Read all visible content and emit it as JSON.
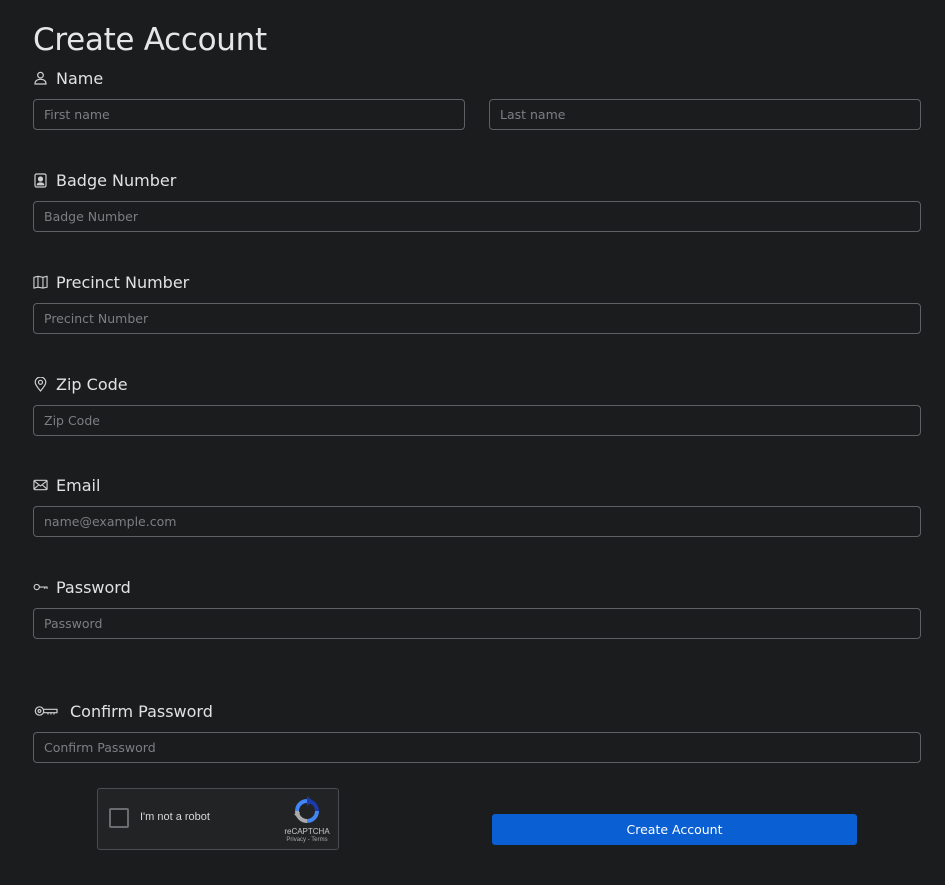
{
  "page": {
    "title": "Create Account"
  },
  "fields": {
    "name": {
      "label": "Name",
      "icon": "person-icon",
      "first": {
        "placeholder": "First name",
        "value": ""
      },
      "last": {
        "placeholder": "Last name",
        "value": ""
      }
    },
    "badge": {
      "label": "Badge Number",
      "icon": "badge-icon",
      "placeholder": "Badge Number",
      "value": ""
    },
    "precinct": {
      "label": "Precinct Number",
      "icon": "map-icon",
      "placeholder": "Precinct Number",
      "value": ""
    },
    "zip": {
      "label": "Zip Code",
      "icon": "location-pin-icon",
      "placeholder": "Zip Code",
      "value": ""
    },
    "email": {
      "label": "Email",
      "icon": "envelope-icon",
      "placeholder": "name@example.com",
      "value": ""
    },
    "password": {
      "label": "Password",
      "icon": "key-icon",
      "placeholder": "Password",
      "value": ""
    },
    "confirm": {
      "label": "Confirm Password",
      "icon": "key-icon",
      "placeholder": "Confirm Password",
      "value": ""
    }
  },
  "recaptcha": {
    "checkbox_label": "I'm not a robot",
    "brand": "reCAPTCHA",
    "links": "Privacy - Terms",
    "checked": false
  },
  "submit": {
    "label": "Create Account",
    "color": "#0a5fd3"
  },
  "colors": {
    "background": "#1b1c1e",
    "input_border": "#5e6064",
    "text": "#e2e2e2",
    "placeholder": "#7c7e82"
  }
}
